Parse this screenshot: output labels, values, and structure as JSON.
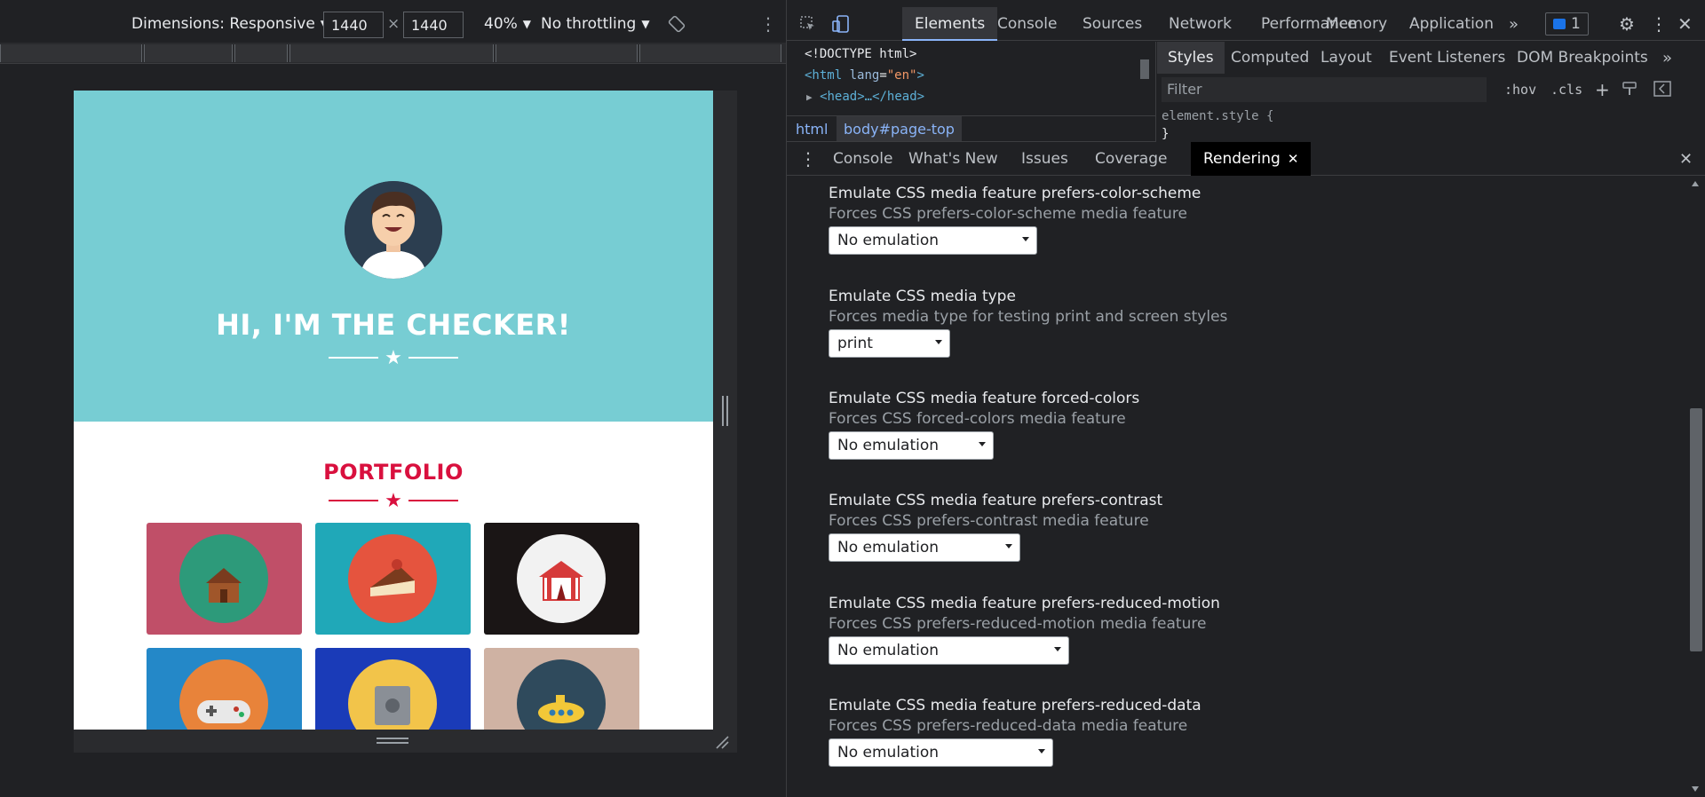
{
  "device_toolbar": {
    "dimensions_label": "Dimensions: Responsive",
    "width_value": "1440",
    "times": "×",
    "height_value": "1440",
    "zoom": "40%",
    "throttling": "No throttling"
  },
  "page": {
    "hero_title": "HI, I'M THE CHECKER!",
    "portfolio_title": "PORTFOLIO",
    "colors": {
      "hero_bg": "#77cdd3",
      "accent": "#d9103e"
    },
    "tiles": [
      {
        "name": "cabin",
        "bg": "#c04f68",
        "circle": "#2d9a7a"
      },
      {
        "name": "cake",
        "bg": "#20a8b8",
        "circle": "#e5543e"
      },
      {
        "name": "circus",
        "bg": "#1a1515",
        "circle": "#f2f2f2"
      },
      {
        "name": "game-controller",
        "bg": "#2488c8",
        "circle": "#e8833a"
      },
      {
        "name": "safe",
        "bg": "#1a3bb8",
        "circle": "#f2c44a"
      },
      {
        "name": "submarine",
        "bg": "#cfb2a3",
        "circle": "#2f4a5c"
      }
    ]
  },
  "devtools": {
    "main_tabs": [
      "Elements",
      "Console",
      "Sources",
      "Network",
      "Performance",
      "Memory",
      "Application"
    ],
    "issues_count": "1",
    "elements": {
      "doctype": "<!DOCTYPE html>",
      "html_open": "<html",
      "lang_attr": "lang",
      "lang_val": "\"en\"",
      "head_collapsed": "<head>…</head>"
    },
    "breadcrumbs": [
      "html",
      "body#page-top"
    ],
    "styles_tabs": [
      "Styles",
      "Computed",
      "Layout",
      "Event Listeners",
      "DOM Breakpoints"
    ],
    "filter_placeholder": "Filter",
    "hov": ":hov",
    "cls": ".cls",
    "element_style": "element.style {",
    "close_brace": "}",
    "drawer_tabs": [
      "Console",
      "What's New",
      "Issues",
      "Coverage",
      "Rendering"
    ],
    "rendering_options": [
      {
        "title": "Emulate CSS media feature prefers-color-scheme",
        "desc": "Forces CSS prefers-color-scheme media feature",
        "value": "No emulation"
      },
      {
        "title": "Emulate CSS media type",
        "desc": "Forces media type for testing print and screen styles",
        "value": "print"
      },
      {
        "title": "Emulate CSS media feature forced-colors",
        "desc": "Forces CSS forced-colors media feature",
        "value": "No emulation"
      },
      {
        "title": "Emulate CSS media feature prefers-contrast",
        "desc": "Forces CSS prefers-contrast media feature",
        "value": "No emulation"
      },
      {
        "title": "Emulate CSS media feature prefers-reduced-motion",
        "desc": "Forces CSS prefers-reduced-motion media feature",
        "value": "No emulation"
      },
      {
        "title": "Emulate CSS media feature prefers-reduced-data",
        "desc": "Forces CSS prefers-reduced-data media feature",
        "value": "No emulation"
      }
    ]
  }
}
